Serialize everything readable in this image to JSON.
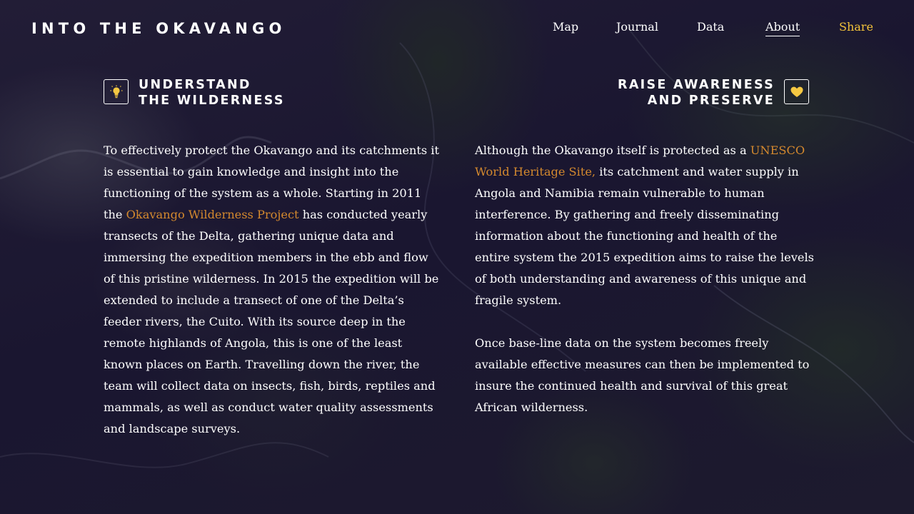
{
  "header": {
    "logo": "INTO THE OKAVANGO",
    "nav": [
      {
        "label": "Map"
      },
      {
        "label": "Journal"
      },
      {
        "label": "Data"
      },
      {
        "label": "About",
        "active": true
      },
      {
        "label": "Share",
        "accent": true
      }
    ]
  },
  "left": {
    "icon": "lightbulb-icon",
    "heading_line1": "UNDERSTAND",
    "heading_line2": "THE WILDERNESS",
    "p1_before": "To effectively protect the Okavango and its catchments it is essential to gain knowledge and insight into the functioning of the system as a whole. Starting in 2011 the ",
    "p1_link": "Okavango Wilderness Project",
    "p1_after": " has conducted yearly transects of the Delta, gathering unique data and immersing the expedition members in the ebb and flow of this pristine wilderness. In 2015 the expedition will be extended to include a transect of one of the Delta’s feeder rivers, the Cuito. With its source deep in the remote highlands of Angola, this is one of the least known places on Earth. Travelling down the river, the team will collect data on insects, fish, birds, reptiles and mammals, as well as conduct water quality assessments and landscape surveys."
  },
  "right": {
    "icon": "heart-icon",
    "heading_line1": "RAISE AWARENESS",
    "heading_line2": "AND PRESERVE",
    "p1_before": "Although the Okavango itself is protected as a ",
    "p1_link": "UNESCO World Heritage Site,",
    "p1_after": " its catchment and water supply in Angola and Namibia remain vulnerable to human interference. By gathering and freely disseminating information about the functioning and health of the entire system the 2015 expedition aims to raise the levels of both understanding and awareness of this unique and fragile system.",
    "p2": "Once base-line data on the system becomes freely available effective measures can then be implemented to insure the continued health and survival of this great African wilderness."
  },
  "colors": {
    "accent_share": "#f2c23a",
    "link": "#d4892e",
    "icon_fill": "#f5c842",
    "background": "#1b1730"
  }
}
